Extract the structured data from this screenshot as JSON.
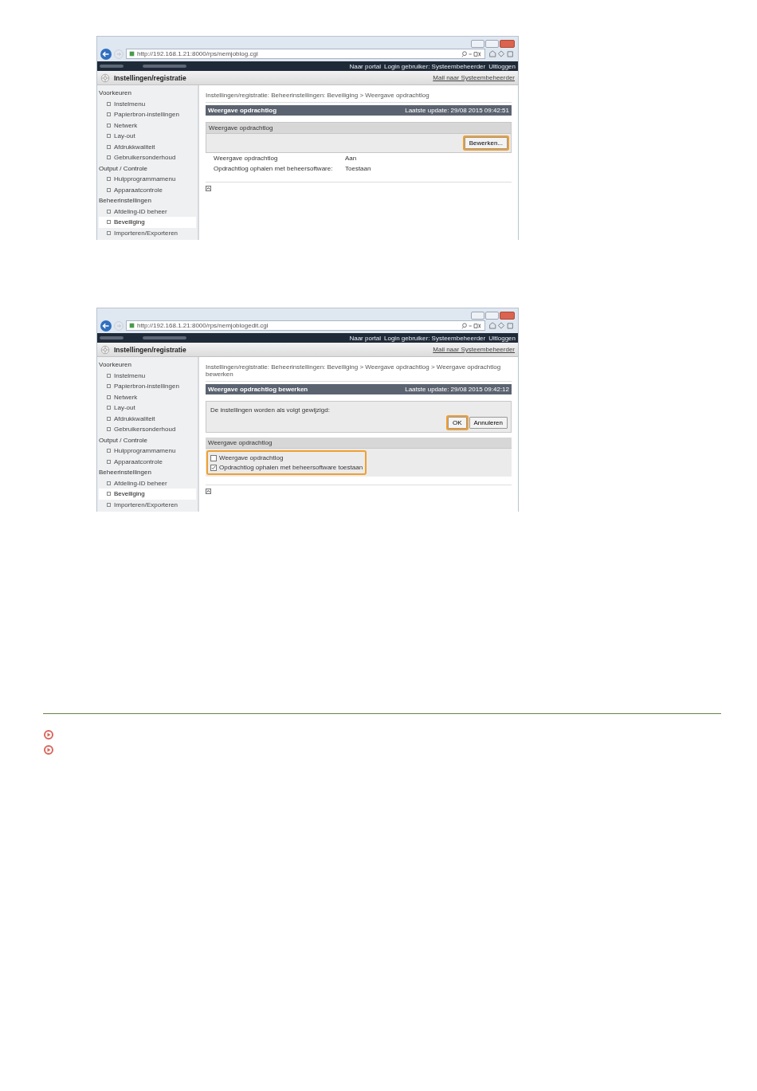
{
  "screenshots": [
    {
      "kind": "view",
      "url": "http://192.168.1.21:8000/rps/nemjoblog.cgi",
      "top_links": [
        "Naar portal",
        "Login gebruiker: Systeembeheerder",
        "Uitloggen"
      ],
      "title": "Instellingen/registratie",
      "admin_link": "Mail naar Systeembeheerder",
      "sidebar": [
        {
          "label": "Voorkeuren",
          "children": [
            {
              "label": "Instelmenu",
              "selected": false
            },
            {
              "label": "Papierbron-instellingen",
              "selected": false
            },
            {
              "label": "Netwerk",
              "selected": false
            },
            {
              "label": "Lay-out",
              "selected": false
            },
            {
              "label": "Afdrukkwaliteit",
              "selected": false
            },
            {
              "label": "Gebruikersonderhoud",
              "selected": false
            }
          ]
        },
        {
          "label": "Output / Controle",
          "children": [
            {
              "label": "Hulpprogrammamenu",
              "selected": false
            },
            {
              "label": "Apparaatcontrole",
              "selected": false
            }
          ]
        },
        {
          "label": "Beheerinstellingen",
          "children": [
            {
              "label": "Afdeling-ID beheer",
              "selected": false
            },
            {
              "label": "Beveiliging",
              "selected": true
            },
            {
              "label": "Importeren/Exporteren",
              "selected": false
            }
          ]
        }
      ],
      "breadcrumb": "Instellingen/registratie: Beheerinstellingen: Beveiliging > Weergave opdrachtlog",
      "header": {
        "title": "Weergave opdrachtlog",
        "updated": "Laatste update: 29/08 2015 09:42:51"
      },
      "section": "Weergave opdrachtlog",
      "buttons": [
        {
          "label": "Bewerken...",
          "highlighted": true
        }
      ],
      "rows": [
        {
          "label": "Weergave opdrachtlog",
          "value": "Aan"
        },
        {
          "label": "Opdrachtlog ophalen met beheersoftware:",
          "value": "Toestaan"
        }
      ]
    },
    {
      "kind": "edit",
      "url": "http://192.168.1.21:8000/rps/nemjoblogedit.cgi",
      "top_links": [
        "Naar portal",
        "Login gebruiker: Systeembeheerder",
        "Uitloggen"
      ],
      "title": "Instellingen/registratie",
      "admin_link": "Mail naar Systeembeheerder",
      "sidebar": [
        {
          "label": "Voorkeuren",
          "children": [
            {
              "label": "Instelmenu",
              "selected": false
            },
            {
              "label": "Papierbron-instellingen",
              "selected": false
            },
            {
              "label": "Netwerk",
              "selected": false
            },
            {
              "label": "Lay-out",
              "selected": false
            },
            {
              "label": "Afdrukkwaliteit",
              "selected": false
            },
            {
              "label": "Gebruikersonderhoud",
              "selected": false
            }
          ]
        },
        {
          "label": "Output / Controle",
          "children": [
            {
              "label": "Hulpprogrammamenu",
              "selected": false
            },
            {
              "label": "Apparaatcontrole",
              "selected": false
            }
          ]
        },
        {
          "label": "Beheerinstellingen",
          "children": [
            {
              "label": "Afdeling-ID beheer",
              "selected": false
            },
            {
              "label": "Beveiliging",
              "selected": true
            },
            {
              "label": "Importeren/Exporteren",
              "selected": false
            }
          ]
        }
      ],
      "breadcrumb": "Instellingen/registratie: Beheerinstellingen: Beveiliging > Weergave opdrachtlog > Weergave opdrachtlog bewerken",
      "header": {
        "title": "Weergave opdrachtlog bewerken",
        "updated": "Laatste update: 29/08 2015 09:42:12"
      },
      "message": "De instellingen worden als volgt gewijzigd:",
      "buttons": [
        {
          "label": "OK",
          "highlighted": true
        },
        {
          "label": "Annuleren",
          "highlighted": false
        }
      ],
      "section": "Weergave opdrachtlog",
      "options_highlighted": true,
      "options": [
        {
          "label": "Weergave opdrachtlog",
          "checked": false
        },
        {
          "label": "Opdrachtlog ophalen met beheersoftware toestaan",
          "checked": true
        }
      ]
    }
  ]
}
